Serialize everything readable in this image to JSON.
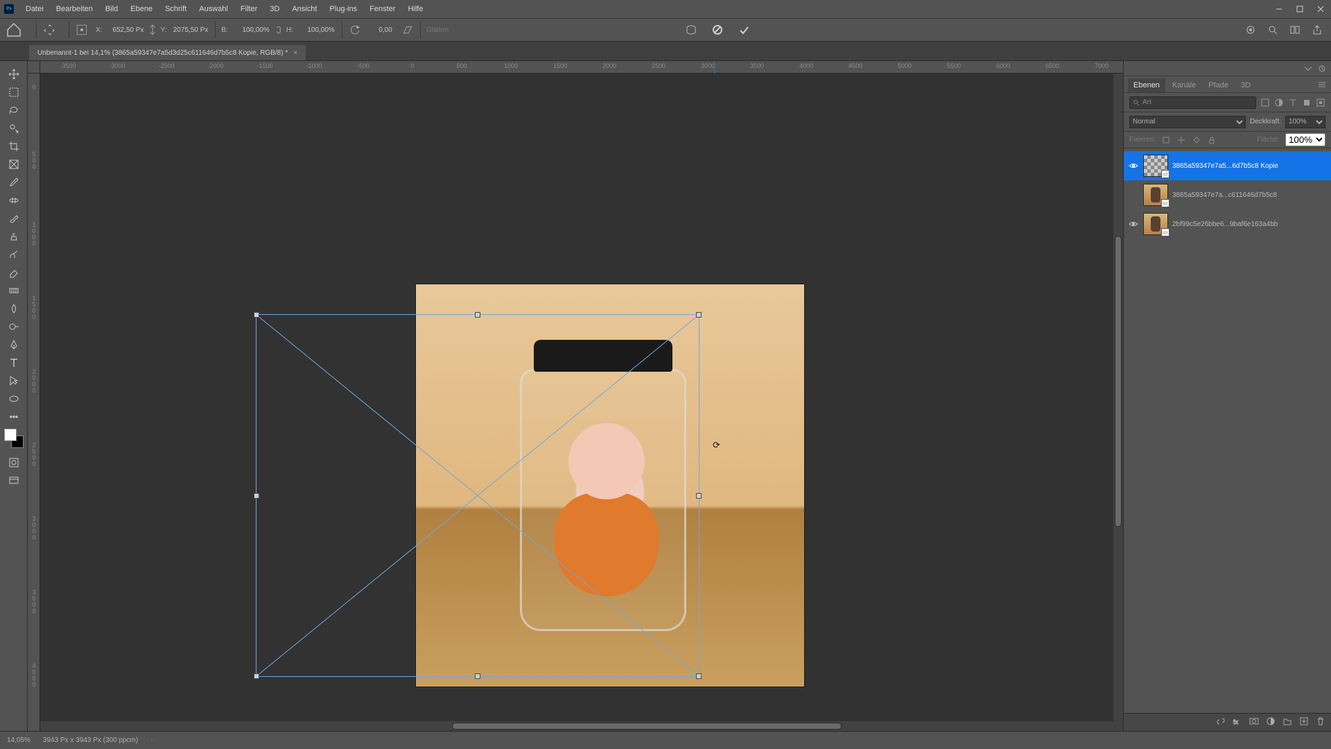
{
  "menu": {
    "items": [
      "Datei",
      "Bearbeiten",
      "Bild",
      "Ebene",
      "Schrift",
      "Auswahl",
      "Filter",
      "3D",
      "Ansicht",
      "Plug-ins",
      "Fenster",
      "Hilfe"
    ]
  },
  "options": {
    "x_label": "X:",
    "x_value": "652,50 Px",
    "y_label": "Y:",
    "y_value": "2075,50 Px",
    "w_label": "B:",
    "w_value": "100,00%",
    "h_label": "H:",
    "h_value": "100,00%",
    "rot_value": "0,00",
    "glatten": "Glätten"
  },
  "doc_tab": {
    "title": "Unbenannt-1 bei 14,1% (3865a59347e7a5d3d25c611646d7b5c8 Kopie, RGB/8) *"
  },
  "ruler_h": [
    "-3500",
    "-3000",
    "-2500",
    "-2000",
    "-1500",
    "-1000",
    "-500",
    "0",
    "500",
    "1000",
    "1500",
    "2000",
    "2500",
    "3000",
    "3500",
    "4000",
    "4500",
    "5000",
    "5500",
    "6000",
    "6500",
    "7000"
  ],
  "ruler_v": [
    "0",
    "500",
    "1000",
    "1500",
    "2000",
    "2500",
    "3000",
    "3500",
    "4000"
  ],
  "panel": {
    "tabs": [
      "Ebenen",
      "Kanäle",
      "Pfade",
      "3D"
    ],
    "search_placeholder": "Art",
    "blend_mode": "Normal",
    "opacity_label": "Deckkraft:",
    "opacity_value": "100%",
    "fix_label": "Fixieren:",
    "fill_label": "Fläche:",
    "fill_value": "100%"
  },
  "layers": [
    {
      "name": "3865a59347e7a5...6d7b5c8 Kopie",
      "visible": true,
      "active": true,
      "thumb": "checker"
    },
    {
      "name": "3865a59347e7a...c611646d7b5c8",
      "visible": false,
      "active": false,
      "thumb": "photo"
    },
    {
      "name": "2bf99c5e26bbe6...9baf6e163a4bb",
      "visible": true,
      "active": false,
      "thumb": "photo"
    }
  ],
  "status": {
    "zoom": "14,05%",
    "dims": "3943 Px x 3943 Px (300 ppcm)"
  }
}
